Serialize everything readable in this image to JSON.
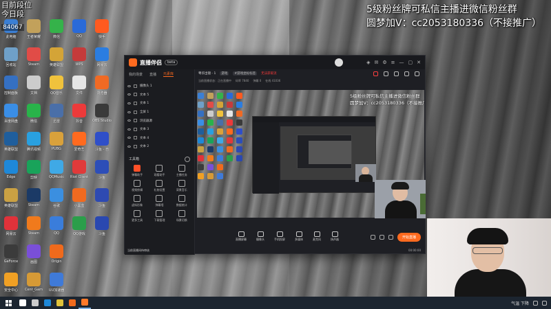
{
  "overlay_top_left": {
    "line1": "目前段位",
    "line2": "今日段",
    "counter": "84067"
  },
  "overlay_top_right": {
    "line1": "5级粉丝牌可私信主播进微信粉丝群",
    "line2": "圆梦加V：cc2053180336（不接推广）"
  },
  "app": {
    "logo": "直播伴侣",
    "version": "beta",
    "tabs": [
      {
        "label": "我的场景"
      },
      {
        "label": "直播"
      },
      {
        "label": "元素库",
        "active": true
      }
    ],
    "scenes": [
      "摄像头 1",
      "文本 5",
      "文本 1",
      "全屏 1",
      "浏览器源",
      "文本 3",
      "文本 4",
      "文本 2"
    ],
    "tools_heading": "工具箱",
    "tools": [
      "弹幕助手",
      "观看助手",
      "主播任务",
      "视频剪辑",
      "礼物设置",
      "背景音乐",
      "虚拟形象",
      "弹幕墙",
      "数据统计",
      "更多工具",
      "下载管理",
      "场景切换"
    ],
    "left_footer": "当前直播间待审核",
    "room": {
      "name": "粤华出镜 - 1",
      "chip": "游戏",
      "chip2": "#游戏坐标标签",
      "warn": "无法获取流"
    },
    "info_row": [
      "当前直播状态：正在直播中",
      "码率 7840",
      "弹幕 0",
      "在线 41036"
    ],
    "bottom": [
      "直播屏幕",
      "摄像头",
      "手机投屏",
      "多媒体",
      "麦克风",
      "扬声器"
    ],
    "start_button": "开始直播",
    "status": "00:00:00"
  },
  "preview_overlay": {
    "line1": "5级粉丝牌可私信主播进微信粉丝群",
    "line2": "圆梦加V：cc2053180336（不接推广）"
  },
  "desktop_icons": [
    {
      "label": "此电脑",
      "color": "#3b7fd4"
    },
    {
      "label": "王者荣耀",
      "color": "#c2a15b"
    },
    {
      "label": "微信",
      "color": "#35b24a"
    },
    {
      "label": "QQ",
      "color": "#2a6ad8"
    },
    {
      "label": "快手",
      "color": "#ff5a1f"
    },
    {
      "label": "回收站",
      "color": "#6fa0c8"
    },
    {
      "label": "Steam",
      "color": "#e14c47"
    },
    {
      "label": "英雄联盟",
      "color": "#d4a437"
    },
    {
      "label": "WPS",
      "color": "#c53b3b"
    },
    {
      "label": "网易云",
      "color": "#2b7de0"
    },
    {
      "label": "控制面板",
      "color": "#3570c2"
    },
    {
      "label": "文档",
      "color": "#cccccc"
    },
    {
      "label": "QQ音乐",
      "color": "#f0c23c"
    },
    {
      "label": "文件",
      "color": "#e6e6e6"
    },
    {
      "label": "浏览器",
      "color": "#f06a24"
    },
    {
      "label": "百度网盘",
      "color": "#3a8ee6"
    },
    {
      "label": "微信",
      "color": "#29b34a"
    },
    {
      "label": "迅雷",
      "color": "#4a6fa8"
    },
    {
      "label": "抖音",
      "color": "#ec3a3a"
    },
    {
      "label": "OBS Studio",
      "color": "#3a3a3a"
    },
    {
      "label": "英雄联盟",
      "color": "#1f5e9c"
    },
    {
      "label": "腾讯视频",
      "color": "#29a0e0"
    },
    {
      "label": "PUBG",
      "color": "#d9a13b"
    },
    {
      "label": "爱奇艺",
      "color": "#ff6a1f"
    },
    {
      "label": "斗鱼 - 自",
      "color": "#2f4fc8"
    },
    {
      "label": "Edge",
      "color": "#1e88d8"
    },
    {
      "label": "剪映",
      "color": "#19a35a"
    },
    {
      "label": "QQMusic",
      "color": "#3fa9e6"
    },
    {
      "label": "Riot Client",
      "color": "#e03a3a"
    },
    {
      "label": "斗鱼",
      "color": "#2d4eb8"
    },
    {
      "label": "英雄联盟",
      "color": "#caa143"
    },
    {
      "label": "Steam",
      "color": "#1b3a66"
    },
    {
      "label": "谷歌",
      "color": "#3b8fe0"
    },
    {
      "label": "小黑盒",
      "color": "#f06a20"
    },
    {
      "label": "斗鱼",
      "color": "#2e4ab2"
    },
    {
      "label": "网易云",
      "color": "#e0323a"
    },
    {
      "label": "Steam",
      "color": "#f07a1c"
    },
    {
      "label": "QQ",
      "color": "#3a7ddb"
    },
    {
      "label": "QQ游戏",
      "color": "#2b9e4a"
    },
    {
      "label": "斗鱼",
      "color": "#2a48b0"
    },
    {
      "label": "GeForce",
      "color": "#3b3b3b"
    },
    {
      "label": "画图",
      "color": "#7a4fd8"
    },
    {
      "label": "Origin",
      "color": "#f06a1c"
    },
    {
      "label": "",
      "color": "#00000000"
    },
    {
      "label": "",
      "color": "#00000000"
    },
    {
      "label": "安全中心",
      "color": "#f0a024"
    },
    {
      "label": "Cent_Gam",
      "color": "#d69a36"
    },
    {
      "label": "UU加速器",
      "color": "#3f7ad8"
    },
    {
      "label": "",
      "color": "#00000000"
    },
    {
      "label": "",
      "color": "#00000000"
    }
  ],
  "taskbar": {
    "apps": [
      {
        "name": "search-icon",
        "color": "#ffffff"
      },
      {
        "name": "task-view-icon",
        "color": "#cccccc"
      },
      {
        "name": "edge-icon",
        "color": "#1e88d8"
      },
      {
        "name": "chrome-icon",
        "color": "#e0c23a"
      },
      {
        "name": "app-g-icon",
        "color": "#f06a1c"
      },
      {
        "name": "live-app-icon",
        "color": "#ff7a2a",
        "active": true
      }
    ],
    "weather": "气温 下降"
  }
}
